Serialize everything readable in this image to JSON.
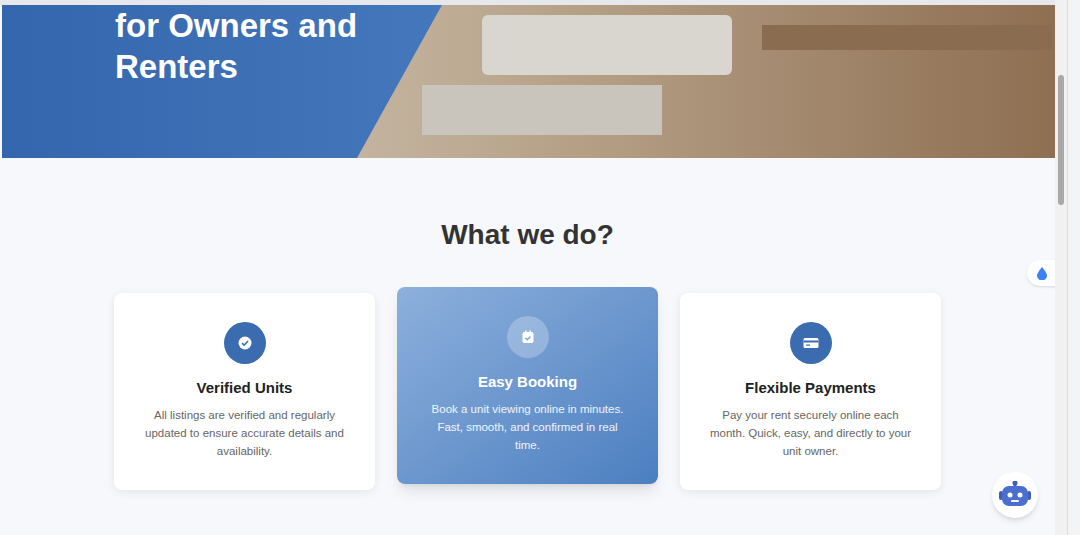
{
  "hero": {
    "title": "for Owners and Renters"
  },
  "section": {
    "heading": "What we do?"
  },
  "cards": [
    {
      "title": "Verified Units",
      "description": "All listings are verified and regularly updated to ensure accurate details and availability.",
      "active": false,
      "kind": "verified"
    },
    {
      "title": "Easy Booking",
      "description": "Book a unit viewing online in minutes. Fast, smooth, and confirmed in real time.",
      "active": true,
      "kind": "booking"
    },
    {
      "title": "Flexible Payments",
      "description": "Pay your rent securely online each month. Quick, easy, and directly to your unit owner.",
      "active": false,
      "kind": "payments"
    }
  ]
}
